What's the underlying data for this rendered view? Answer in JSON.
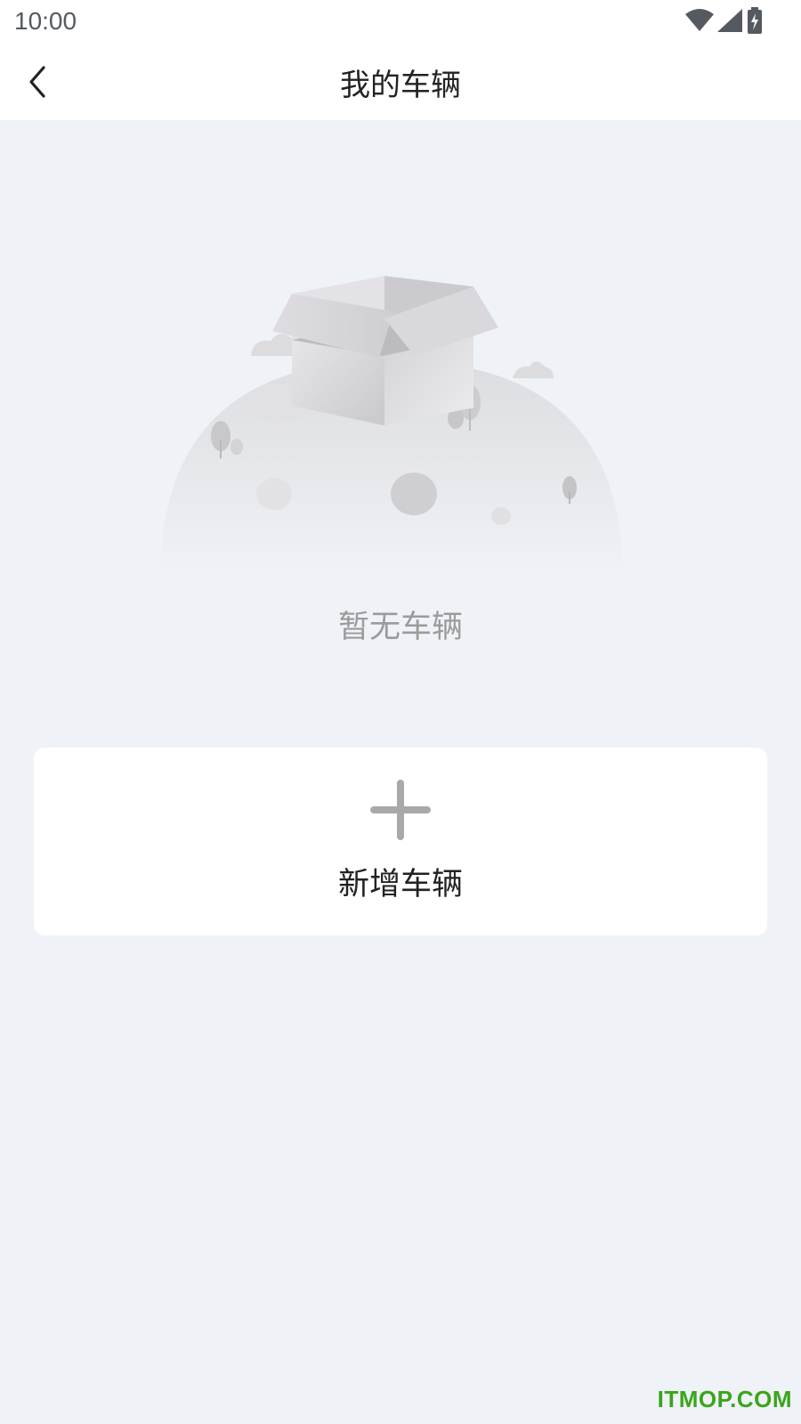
{
  "status_bar": {
    "time": "10:00",
    "icons": [
      "wifi-icon",
      "cellular-signal-icon",
      "battery-charging-icon"
    ]
  },
  "nav": {
    "title": "我的车辆",
    "back_icon": "chevron-left-icon"
  },
  "empty_state": {
    "illustration": "empty-box-illustration",
    "message": "暂无车辆"
  },
  "add_vehicle": {
    "icon": "plus-icon",
    "label": "新增车辆"
  },
  "watermark": {
    "text": "ITMOP.COM"
  },
  "colors": {
    "page_background": "#eff2f7",
    "header_background": "#ffffff",
    "card_background": "#ffffff",
    "muted_text": "#9b9b9b",
    "primary_text": "#222222",
    "watermark": "#3aa51a"
  }
}
